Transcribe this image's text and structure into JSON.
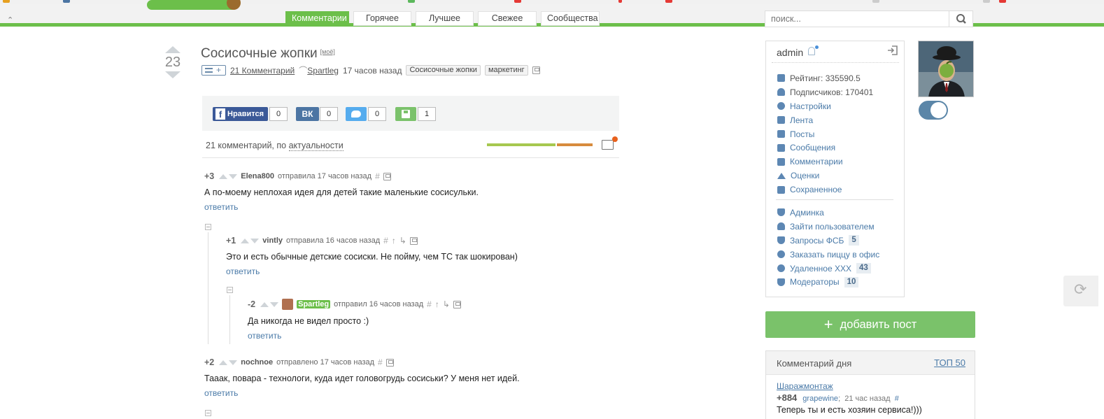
{
  "nav": {
    "tabs": [
      "Комментарии",
      "Горячее",
      "Лучшее",
      "Свежее",
      "Сообщества"
    ],
    "active_tab": "Комментарии",
    "search_placeholder": "поиск..."
  },
  "post": {
    "rating": "23",
    "title": "Сосисочные жопки",
    "mine_label": "[моё]",
    "comments_link": "21 Комментарий",
    "tree_plus": "+",
    "author": "Spartleg",
    "time": "17 часов назад",
    "tags": [
      "Сосисочные жопки",
      "маркетинг"
    ]
  },
  "share": {
    "facebook_label": "Нравится",
    "facebook_count": "0",
    "vk_label": "ВК",
    "vk_count": "0",
    "twitter_count": "0",
    "save_count": "1"
  },
  "sort": {
    "count_text": "21 комментарий, по",
    "order": "актуальности",
    "positive_share": 0.65
  },
  "comments": [
    {
      "rating": "+3",
      "author": "Elena800",
      "action": "отправила 17 часов назад",
      "text": "А по-моему неплохая идея для детей такие маленькие сосисульки.",
      "reply": "ответить"
    },
    {
      "rating": "+1",
      "author": "vintly",
      "action": "отправила 16 часов назад",
      "text": "Это и есть обычные детские сосиски. Не пойму, чем ТС так шокирован)",
      "reply": "ответить"
    },
    {
      "rating": "-2",
      "author": "Spartleg",
      "action": "отправил 16 часов назад",
      "text": "Да никогда не видел просто :)",
      "reply": "ответить"
    },
    {
      "rating": "+2",
      "author": "nochnoe",
      "action": "отправлено 17 часов назад",
      "text": "Тааак, повара - технологи, куда идет головогрудь сосиськи? У меня нет идей.",
      "reply": "ответить"
    }
  ],
  "profile": {
    "username": "admin",
    "stats": [
      "Рейтинг: 335590.5",
      "Подписчиков: 170401"
    ],
    "links": [
      "Настройки",
      "Лента",
      "Посты",
      "Сообщения",
      "Комментарии",
      "Оценки",
      "Сохраненное"
    ],
    "admin_links": [
      {
        "label": "Админка",
        "badge": ""
      },
      {
        "label": "Зайти пользователем",
        "badge": ""
      },
      {
        "label": "Запросы ФСБ",
        "badge": "5"
      },
      {
        "label": "Заказать пиццу в офис",
        "badge": ""
      },
      {
        "label": "Удаленное XXX",
        "badge": "43"
      },
      {
        "label": "Модераторы",
        "badge": "10"
      }
    ],
    "toggle_on": true
  },
  "sidebar": {
    "add_post_label": "добавить пост",
    "cod_title": "Комментарий дня",
    "cod_top": "ТОП 50",
    "cod_post": "Шаражмонтаж",
    "cod_rating": "+884",
    "cod_author": "grapewine",
    "cod_time": "21 час назад",
    "cod_hash": "#",
    "cod_text": "Теперь ты и есть хозяин сервиса!)))"
  },
  "colors": {
    "accent": "#6cbf4a",
    "link": "#4a7aa8",
    "facebook": "#3b5998",
    "vk": "#4c75a3",
    "twitter": "#55acee",
    "rating_negative": "#d78b3d"
  }
}
